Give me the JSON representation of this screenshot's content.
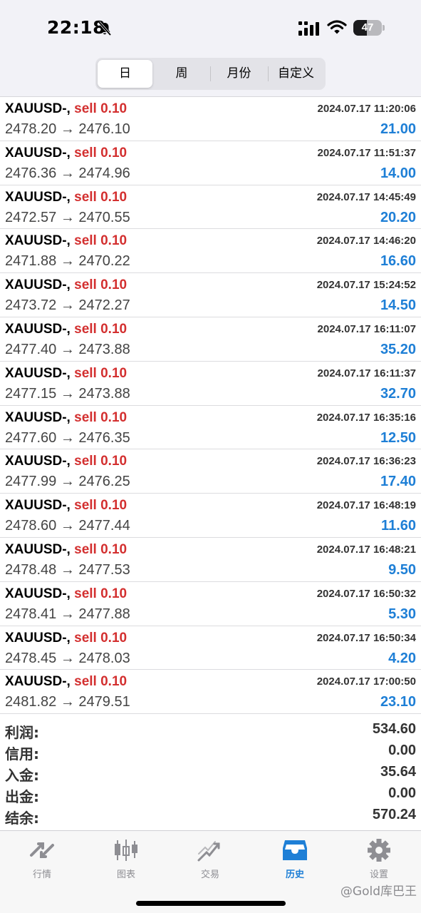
{
  "status_bar": {
    "time": "22:18",
    "battery": "47",
    "battery_level": 0.47
  },
  "segments": [
    {
      "label": "日",
      "active": true
    },
    {
      "label": "周",
      "active": false
    },
    {
      "label": "月份",
      "active": false
    },
    {
      "label": "自定义",
      "active": false
    }
  ],
  "trades": [
    {
      "symbol": "XAUUSD-,",
      "side": "sell 0.10",
      "time": "2024.07.17 11:20:06",
      "prices": "2478.20 → 2476.10",
      "profit": "21.00"
    },
    {
      "symbol": "XAUUSD-,",
      "side": "sell 0.10",
      "time": "2024.07.17 11:51:37",
      "prices": "2476.36 → 2474.96",
      "profit": "14.00"
    },
    {
      "symbol": "XAUUSD-,",
      "side": "sell 0.10",
      "time": "2024.07.17 14:45:49",
      "prices": "2472.57 → 2470.55",
      "profit": "20.20"
    },
    {
      "symbol": "XAUUSD-,",
      "side": "sell 0.10",
      "time": "2024.07.17 14:46:20",
      "prices": "2471.88 → 2470.22",
      "profit": "16.60"
    },
    {
      "symbol": "XAUUSD-,",
      "side": "sell 0.10",
      "time": "2024.07.17 15:24:52",
      "prices": "2473.72 → 2472.27",
      "profit": "14.50"
    },
    {
      "symbol": "XAUUSD-,",
      "side": "sell 0.10",
      "time": "2024.07.17 16:11:07",
      "prices": "2477.40 → 2473.88",
      "profit": "35.20"
    },
    {
      "symbol": "XAUUSD-,",
      "side": "sell 0.10",
      "time": "2024.07.17 16:11:37",
      "prices": "2477.15 → 2473.88",
      "profit": "32.70"
    },
    {
      "symbol": "XAUUSD-,",
      "side": "sell 0.10",
      "time": "2024.07.17 16:35:16",
      "prices": "2477.60 → 2476.35",
      "profit": "12.50"
    },
    {
      "symbol": "XAUUSD-,",
      "side": "sell 0.10",
      "time": "2024.07.17 16:36:23",
      "prices": "2477.99 → 2476.25",
      "profit": "17.40"
    },
    {
      "symbol": "XAUUSD-,",
      "side": "sell 0.10",
      "time": "2024.07.17 16:48:19",
      "prices": "2478.60 → 2477.44",
      "profit": "11.60"
    },
    {
      "symbol": "XAUUSD-,",
      "side": "sell 0.10",
      "time": "2024.07.17 16:48:21",
      "prices": "2478.48 → 2477.53",
      "profit": "9.50"
    },
    {
      "symbol": "XAUUSD-,",
      "side": "sell 0.10",
      "time": "2024.07.17 16:50:32",
      "prices": "2478.41 → 2477.88",
      "profit": "5.30"
    },
    {
      "symbol": "XAUUSD-,",
      "side": "sell 0.10",
      "time": "2024.07.17 16:50:34",
      "prices": "2478.45 → 2478.03",
      "profit": "4.20"
    },
    {
      "symbol": "XAUUSD-,",
      "side": "sell 0.10",
      "time": "2024.07.17 17:00:50",
      "prices": "2481.82 → 2479.51",
      "profit": "23.10"
    }
  ],
  "summary": [
    {
      "label": "利润:",
      "value": "534.60"
    },
    {
      "label": "信用:",
      "value": "0.00"
    },
    {
      "label": "入金:",
      "value": "35.64"
    },
    {
      "label": "出金:",
      "value": "0.00"
    },
    {
      "label": "结余:",
      "value": "570.24"
    }
  ],
  "tabbar": {
    "items": [
      {
        "label": "行情",
        "icon": "quotes-icon",
        "active": false
      },
      {
        "label": "图表",
        "icon": "chart-icon",
        "active": false
      },
      {
        "label": "交易",
        "icon": "trade-icon",
        "active": false
      },
      {
        "label": "历史",
        "icon": "history-icon",
        "active": true
      },
      {
        "label": "设置",
        "icon": "settings-icon",
        "active": false
      }
    ],
    "watermark": "@Gold库巴王"
  },
  "colors": {
    "sell": "#d32f2f",
    "profit": "#1e7fd6",
    "active_tab": "#1e7fd6",
    "inactive_tab": "#8e8e93"
  }
}
